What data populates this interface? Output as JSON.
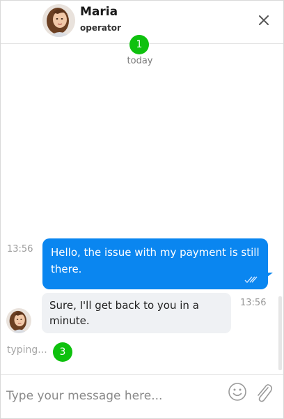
{
  "header": {
    "agent_name": "Maria",
    "agent_role": "operator",
    "close_icon": "close-icon"
  },
  "badges": [
    "1",
    "3"
  ],
  "date_separator": "today",
  "messages": [
    {
      "direction": "outgoing",
      "time": "13:56",
      "text": "Hello, the issue with my payment is still there.",
      "status_icon": "double-check-icon"
    },
    {
      "direction": "incoming",
      "time": "13:56",
      "text": "Sure, I'll get back to you in a minute."
    }
  ],
  "typing_indicator": "typing...",
  "composer": {
    "placeholder": "Type your message here...",
    "emoji_icon": "smiley-icon",
    "attach_icon": "paperclip-icon"
  },
  "colors": {
    "outgoing_bubble": "#0a86f0",
    "incoming_bubble": "#eff1f4",
    "badge": "#0ec10e"
  }
}
